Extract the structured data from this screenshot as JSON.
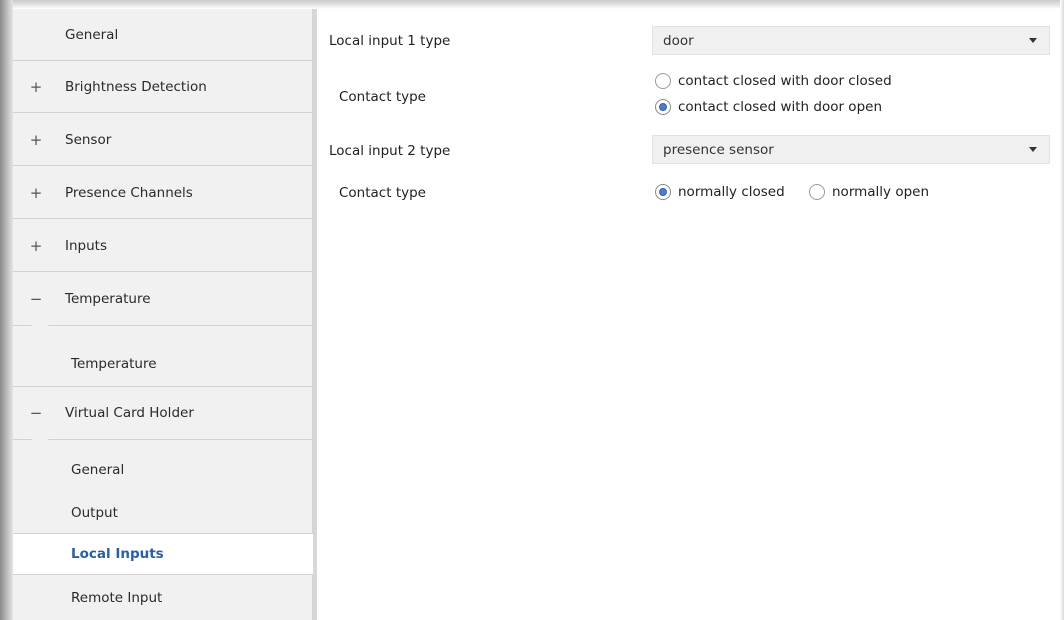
{
  "sidebar": {
    "items": [
      {
        "sign": "",
        "label": "General"
      },
      {
        "sign": "+",
        "label": "Brightness Detection"
      },
      {
        "sign": "+",
        "label": "Sensor"
      },
      {
        "sign": "+",
        "label": "Presence Channels"
      },
      {
        "sign": "+",
        "label": "Inputs"
      },
      {
        "sign": "−",
        "label": "Temperature"
      },
      {
        "sign": "",
        "label": "Temperature"
      },
      {
        "sign": "−",
        "label": "Virtual Card Holder"
      },
      {
        "sign": "",
        "label": "General"
      },
      {
        "sign": "",
        "label": "Output"
      },
      {
        "sign": "",
        "label": "Local Inputs"
      },
      {
        "sign": "",
        "label": "Remote Input"
      }
    ],
    "selected_label": "Local Inputs"
  },
  "main": {
    "local_input_1": {
      "label": "Local input 1 type",
      "value": "door"
    },
    "contact_type_1": {
      "label": "Contact type",
      "options": [
        "contact closed with door closed",
        "contact closed with door open"
      ],
      "selected": "contact closed with door open"
    },
    "local_input_2": {
      "label": "Local input 2 type",
      "value": "presence sensor"
    },
    "contact_type_2": {
      "label": "Contact type",
      "options": [
        "normally closed",
        "normally open"
      ],
      "selected": "normally closed"
    }
  },
  "colors": {
    "accent": "#2b5fa5",
    "radio_fill": "#4d7cc9",
    "sidebar_bg": "#f1f1f1"
  },
  "icons": {
    "expand": "plus-icon",
    "collapse": "minus-icon",
    "dropdown": "caret-down-icon"
  }
}
